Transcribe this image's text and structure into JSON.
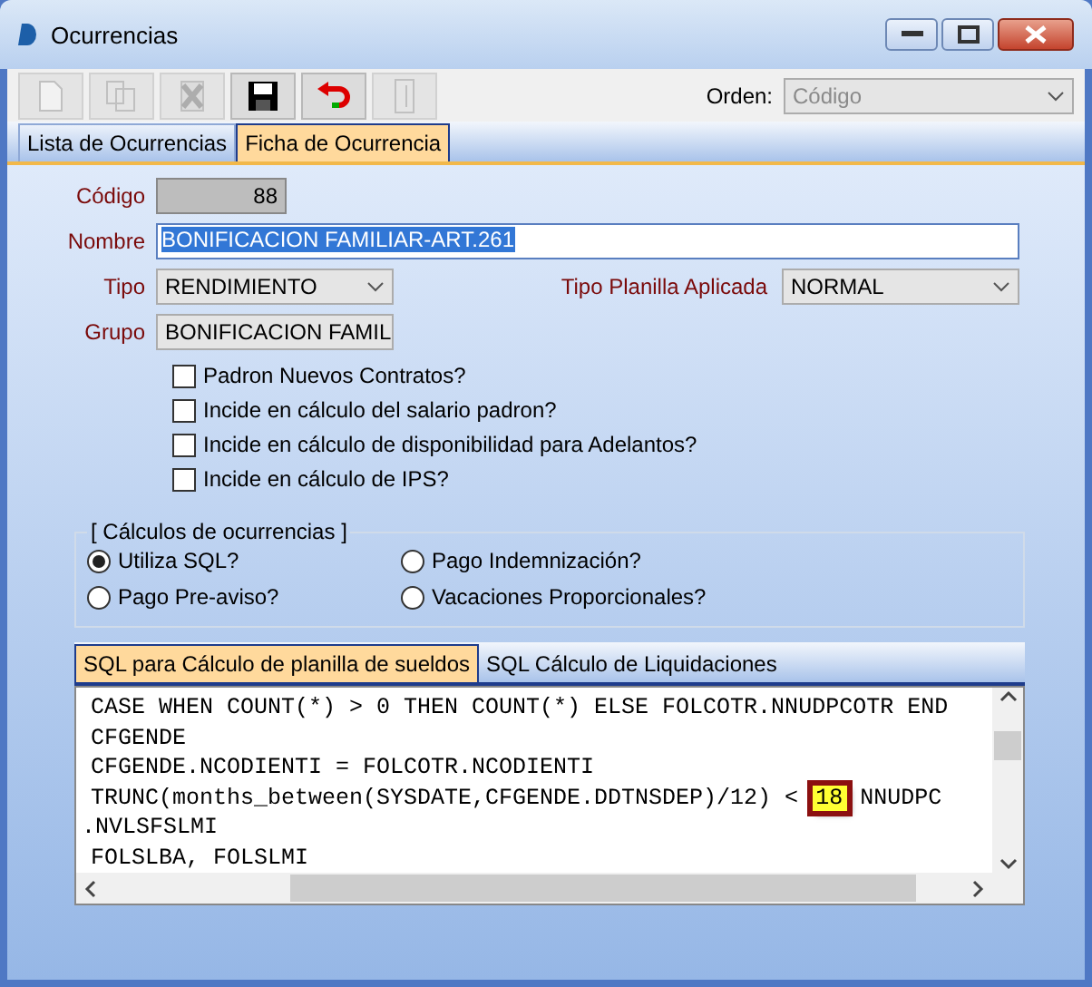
{
  "window": {
    "title": "Ocurrencias"
  },
  "toolbar": [
    {
      "kind": "new",
      "disabled": true
    },
    {
      "kind": "copy",
      "disabled": true
    },
    {
      "kind": "delete",
      "disabled": true
    },
    {
      "kind": "save",
      "disabled": false
    },
    {
      "kind": "undo",
      "disabled": false
    },
    {
      "kind": "exit",
      "disabled": true
    }
  ],
  "order": {
    "label": "Orden:",
    "value": "Código",
    "disabled": true
  },
  "tabs": [
    {
      "label": "Lista de Ocurrencias",
      "selected": false
    },
    {
      "label": "Ficha de Ocurrencia",
      "selected": true
    }
  ],
  "form": {
    "codigo": {
      "label": "Código",
      "value": "88"
    },
    "nombre": {
      "label": "Nombre",
      "value": "BONIFICACION FAMILIAR-ART.261"
    },
    "tipo": {
      "label": "Tipo",
      "value": "RENDIMIENTO"
    },
    "tipo_planilla": {
      "label": "Tipo Planilla Aplicada",
      "value": "NORMAL"
    },
    "grupo": {
      "label": "Grupo",
      "value": "BONIFICACION FAMIL"
    },
    "checkboxes": [
      {
        "label": "Padron Nuevos Contratos?",
        "checked": false
      },
      {
        "label": "Incide en cálculo del salario padron?",
        "checked": false
      },
      {
        "label": "Incide en cálculo de disponibilidad para Adelantos?",
        "checked": false
      },
      {
        "label": "Incide en cálculo de IPS?",
        "checked": false
      }
    ]
  },
  "calculos": {
    "title": "[ Cálculos de ocurrencias ]",
    "options": [
      {
        "label": "Utiliza SQL?",
        "selected": true
      },
      {
        "label": "Pago Indemnización?",
        "selected": false
      },
      {
        "label": "Pago Pre-aviso?",
        "selected": false
      },
      {
        "label": "Vacaciones Proporcionales?",
        "selected": false
      }
    ]
  },
  "sql_tabs": [
    {
      "label": "SQL para Cálculo de planilla de sueldos",
      "selected": true
    },
    {
      "label": "SQL Cálculo de Liquidaciones",
      "selected": false
    }
  ],
  "sql_lines": [
    {
      "text": "CASE WHEN COUNT(*) > 0 THEN COUNT(*) ELSE FOLCOTR.NNUDPCOTR END"
    },
    {
      "text": "CFGENDE"
    },
    {
      "text": "CFGENDE.NCODIENTI = FOLCOTR.NCODIENTI"
    },
    {
      "text": "TRUNC(months_between(SYSDATE,CFGENDE.DDTNSDEP)/12) <",
      "highlight": "18",
      "rest": "NNUDPC"
    },
    {
      "text": ".NVLSFSLMI",
      "outdent": true
    },
    {
      "text": "FOLSLBA, FOLSLMI",
      "outdent": false
    }
  ]
}
